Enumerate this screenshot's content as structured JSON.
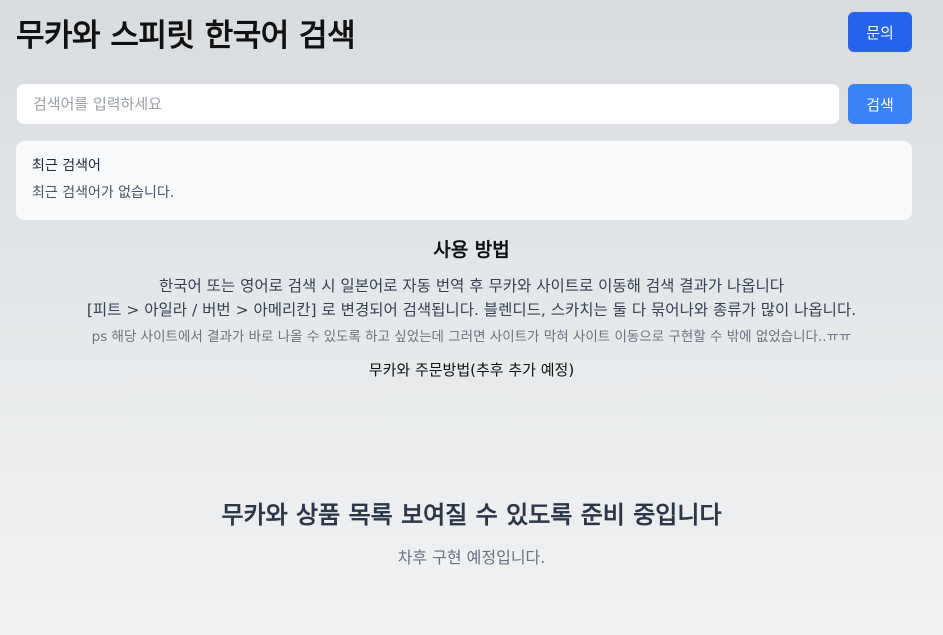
{
  "header": {
    "title": "무카와 스피릿 한국어 검색",
    "contact_button": "문의"
  },
  "search": {
    "placeholder": "검색어를 입력하세요",
    "value": "",
    "button_label": "검색"
  },
  "recent": {
    "title": "최근 검색어",
    "empty_text": "최근 검색어가 없습니다."
  },
  "usage": {
    "heading": "사용 방법",
    "line1": "한국어 또는 영어로 검색 시 일본어로 자동 번역 후 무카와 사이트로 이동해 검색 결과가 나옵니다",
    "line2": "[피트 > 아일라 / 버번 > 아메리칸] 로 변경되어 검색됩니다. 블렌디드, 스카치는 둘 다 묶어나와 종류가 많이 나옵니다.",
    "note": "ps 해당 사이트에서 결과가 바로 나올 수 있도록 하고 싶었는데 그러면 사이트가 막혀 사이트 이동으로 구현할 수 밖에 없었습니다..ㅠㅠ",
    "order_method": "무카와 주문방법(추후 추가 예정)"
  },
  "products": {
    "heading": "무카와 상품 목록 보여질 수 있도록 준비 중입니다",
    "subtext": "차후 구현 예정입니다."
  },
  "colors": {
    "primary": "#2563eb",
    "search_button": "#3b82f6"
  }
}
